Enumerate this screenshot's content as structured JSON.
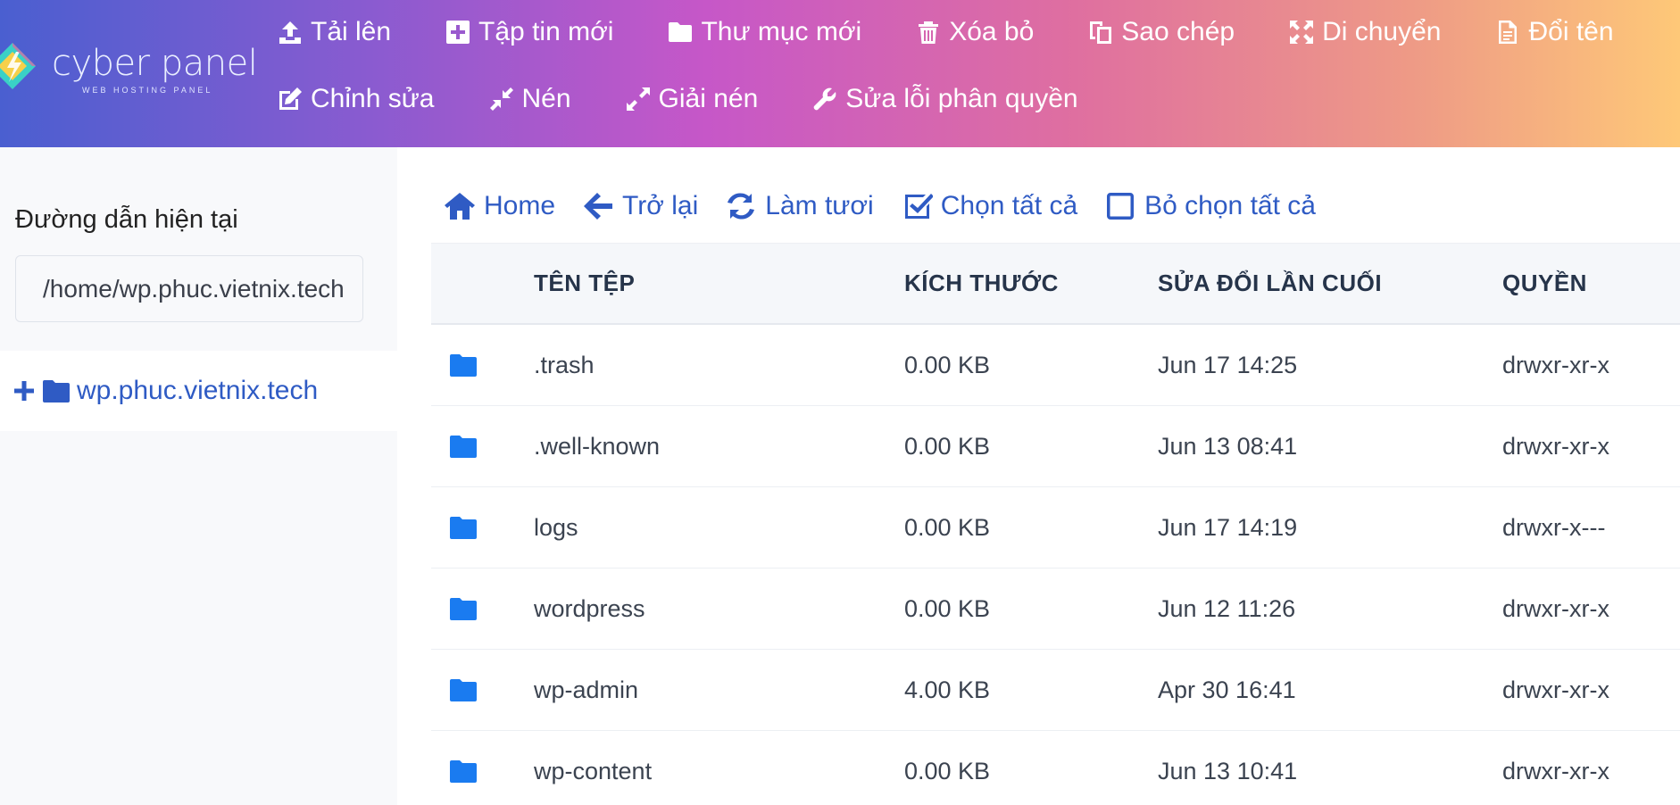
{
  "logo": {
    "name": "cyber panel",
    "tagline": "WEB HOSTING PANEL"
  },
  "toolbar": {
    "row1": [
      {
        "label": "Tải lên",
        "icon": "upload-icon"
      },
      {
        "label": "Tập tin mới",
        "icon": "plus-square-icon"
      },
      {
        "label": "Thư mục mới",
        "icon": "folder-icon"
      },
      {
        "label": "Xóa bỏ",
        "icon": "trash-icon"
      },
      {
        "label": "Sao chép",
        "icon": "copy-icon"
      },
      {
        "label": "Di chuyển",
        "icon": "move-icon"
      },
      {
        "label": "Đổi tên",
        "icon": "file-text-icon"
      }
    ],
    "row2": [
      {
        "label": "Chỉnh sửa",
        "icon": "edit-icon"
      },
      {
        "label": "Nén",
        "icon": "compress-icon"
      },
      {
        "label": "Giải nén",
        "icon": "expand-icon"
      },
      {
        "label": "Sửa lỗi phân quyền",
        "icon": "wrench-icon"
      }
    ]
  },
  "sidebar": {
    "path_label": "Đường dẫn hiện tại",
    "path_value": "/home/wp.phuc.vietnix.tech",
    "tree_root": "wp.phuc.vietnix.tech"
  },
  "nav": {
    "home": "Home",
    "back": "Trở lại",
    "refresh": "Làm tươi",
    "select_all": "Chọn tất cả",
    "deselect_all": "Bỏ chọn tất cả"
  },
  "table": {
    "headers": {
      "name": "TÊN TỆP",
      "size": "KÍCH THƯỚC",
      "modified": "SỬA ĐỔI LẦN CUỐI",
      "perm": "QUYỀN"
    },
    "rows": [
      {
        "name": ".trash",
        "size": "0.00 KB",
        "modified": "Jun 17 14:25",
        "perm": "drwxr-xr-x"
      },
      {
        "name": ".well-known",
        "size": "0.00 KB",
        "modified": "Jun 13 08:41",
        "perm": "drwxr-xr-x"
      },
      {
        "name": "logs",
        "size": "0.00 KB",
        "modified": "Jun 17 14:19",
        "perm": "drwxr-x---"
      },
      {
        "name": "wordpress",
        "size": "0.00 KB",
        "modified": "Jun 12 11:26",
        "perm": "drwxr-xr-x"
      },
      {
        "name": "wp-admin",
        "size": "4.00 KB",
        "modified": "Apr 30 16:41",
        "perm": "drwxr-xr-x"
      },
      {
        "name": "wp-content",
        "size": "0.00 KB",
        "modified": "Jun 13 10:41",
        "perm": "drwxr-xr-x"
      }
    ]
  }
}
